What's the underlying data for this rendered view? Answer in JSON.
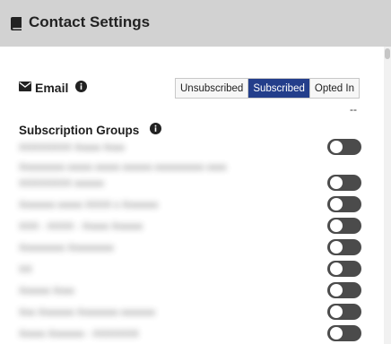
{
  "header": {
    "title": "Contact Settings",
    "icon": "book-icon"
  },
  "email": {
    "label": "Email",
    "icon": "envelope-icon",
    "info_icon": "info-icon",
    "status_options": [
      "Unsubscribed",
      "Subscribed",
      "Opted In"
    ],
    "selected_status": "Subscribed",
    "accent_color": "#233e8b",
    "empty_value": "--"
  },
  "subscription_groups": {
    "label": "Subscription Groups",
    "info_icon": "info-icon",
    "items": [
      {
        "label": "XXXXXXXX Xxxxx Xxxx",
        "subscribed": false
      },
      {
        "label": "Xxxxxxxxx xxxxx xxxxx xxxxxx xxxxxxxxxx xxxx",
        "label_line2": "XXXXXXXX xxxxxx",
        "subscribed": false
      },
      {
        "label": "Xxxxxxx xxxxx XXXX x Xxxxxxx",
        "subscribed": false
      },
      {
        "label": "XXX - XXXX - Xxxxx Xxxxxx",
        "subscribed": false
      },
      {
        "label": "Xxxxxxxxx Xxxxxxxxx",
        "subscribed": false
      },
      {
        "label": "XX",
        "subscribed": false
      },
      {
        "label": "Xxxxxx Xxxx",
        "subscribed": false
      },
      {
        "label": "Xxx Xxxxxxx Xxxxxxxx xxxxxxx",
        "subscribed": false
      },
      {
        "label": "Xxxxx Xxxxxxx - XXXXXXX",
        "subscribed": false
      }
    ]
  }
}
